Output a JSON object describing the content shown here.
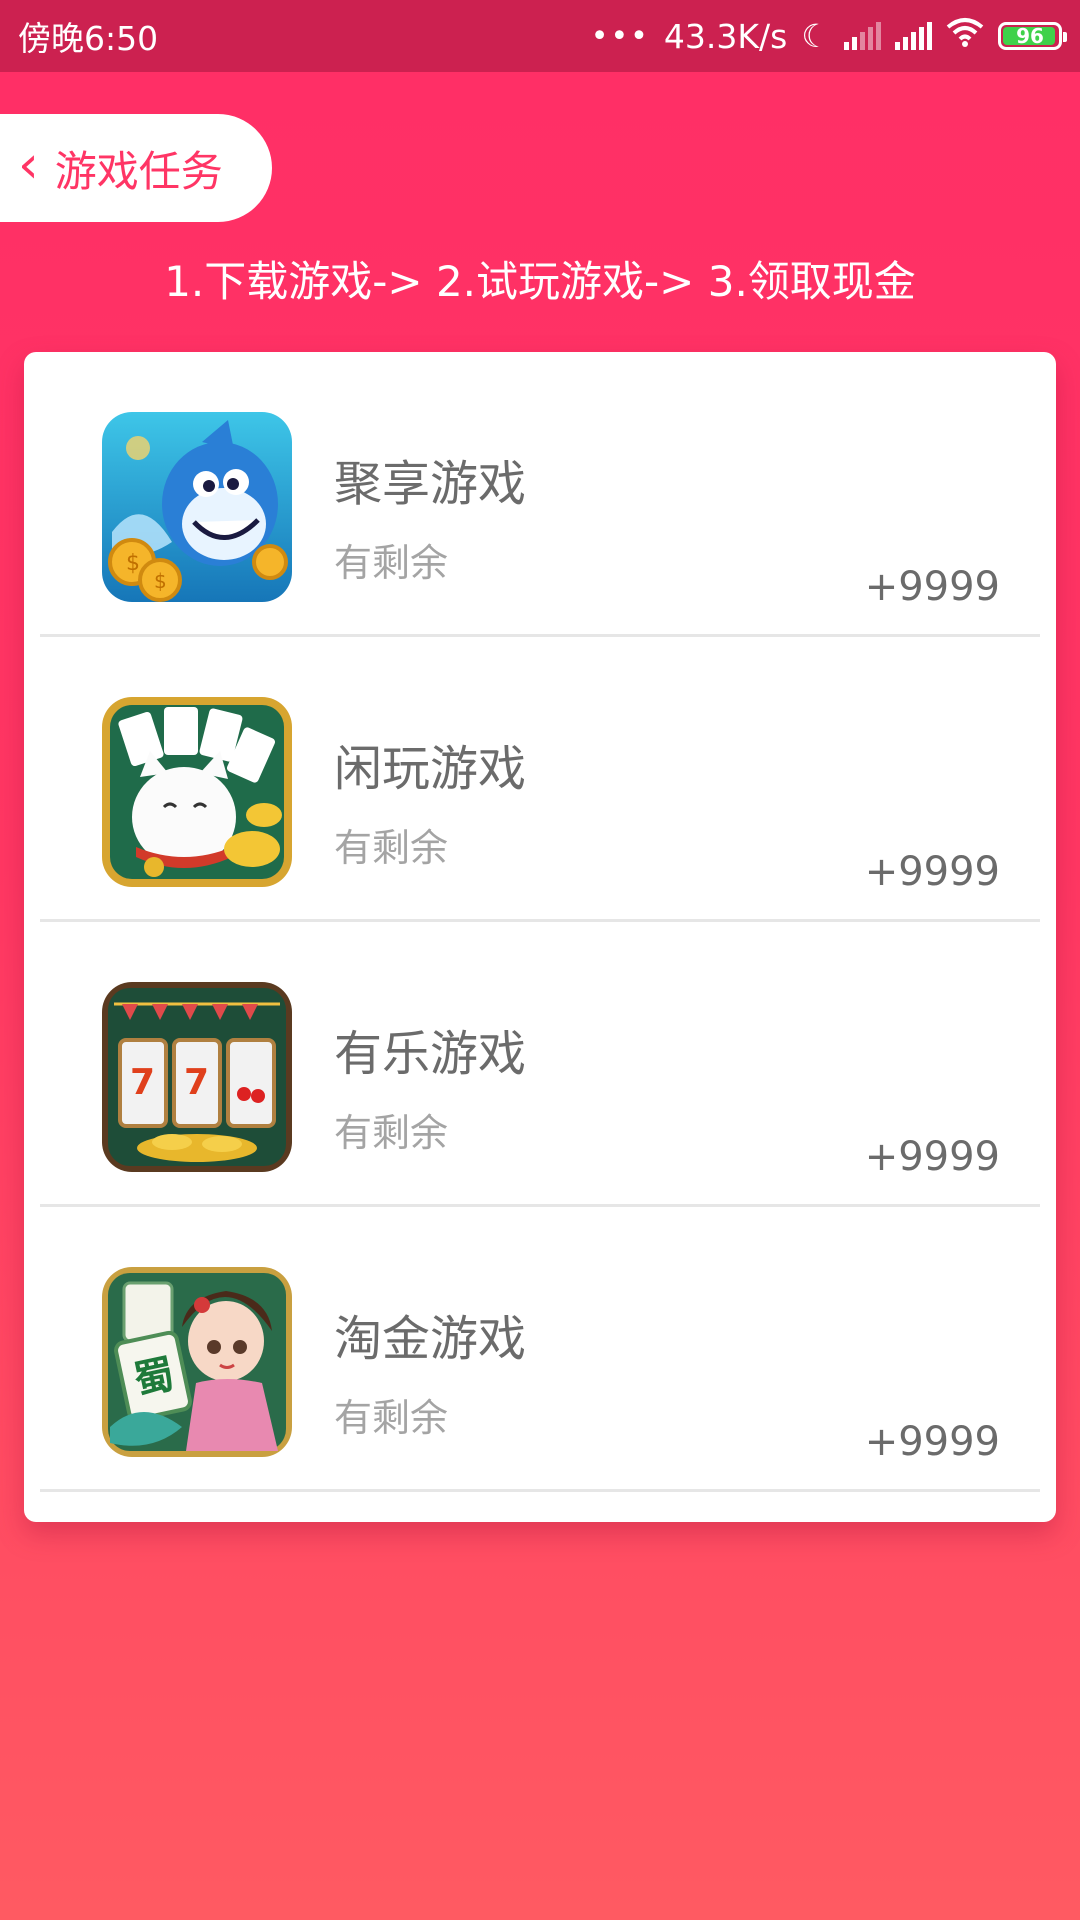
{
  "status_bar": {
    "time": "傍晚6:50",
    "network_speed": "43.3K/s",
    "battery_level": "96",
    "icons": [
      "dots-icon",
      "moon-icon",
      "signal-icon",
      "signal-icon",
      "wifi-icon",
      "battery-icon"
    ]
  },
  "header": {
    "back_icon": "chevron-left-icon",
    "title": "游戏任务"
  },
  "steps": "1.下载游戏-> 2.试玩游戏-> 3.领取现金",
  "colors": {
    "accent": "#ff3565",
    "status_bar": "#cc2150",
    "background_top": "#ff2e66",
    "background_bottom": "#ff5a62"
  },
  "games": [
    {
      "name": "聚享游戏",
      "status": "有剩余",
      "reward": "+9999",
      "icon": "shark-game-icon"
    },
    {
      "name": "闲玩游戏",
      "status": "有剩余",
      "reward": "+9999",
      "icon": "lucky-cat-cards-icon"
    },
    {
      "name": "有乐游戏",
      "status": "有剩余",
      "reward": "+9999",
      "icon": "slot-machine-icon"
    },
    {
      "name": "淘金游戏",
      "status": "有剩余",
      "reward": "+9999",
      "icon": "mahjong-girl-icon"
    }
  ]
}
